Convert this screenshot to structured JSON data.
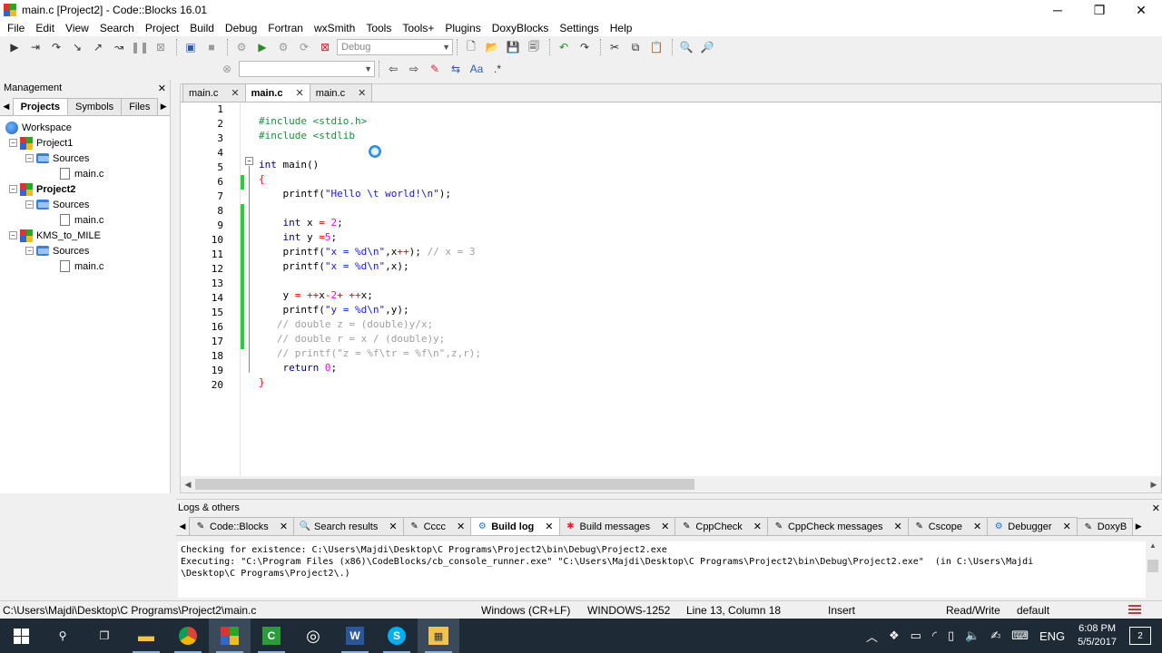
{
  "window": {
    "title": "main.c [Project2] - Code::Blocks 16.01",
    "minimize": "─",
    "maximize": "❐",
    "close": "✕"
  },
  "menu": [
    "File",
    "Edit",
    "View",
    "Search",
    "Project",
    "Build",
    "Debug",
    "Fortran",
    "wxSmith",
    "Tools",
    "Tools+",
    "Plugins",
    "DoxyBlocks",
    "Settings",
    "Help"
  ],
  "toolbar": {
    "build_target": "Debug",
    "search_combo": ""
  },
  "management": {
    "title": "Management",
    "tabs": [
      "Projects",
      "Symbols",
      "Files"
    ],
    "workspace": "Workspace",
    "projects": [
      {
        "name": "Project1",
        "folder": "Sources",
        "file": "main.c"
      },
      {
        "name": "Project2",
        "folder": "Sources",
        "file": "main.c"
      },
      {
        "name": "KMS_to_MILE",
        "folder": "Sources",
        "file": "main.c"
      }
    ]
  },
  "editor_tabs": [
    {
      "label": "main.c",
      "active": false
    },
    {
      "label": "main.c",
      "active": true
    },
    {
      "label": "main.c",
      "active": false
    }
  ],
  "line_numbers": [
    "1",
    "2",
    "3",
    "4",
    "5",
    "6",
    "7",
    "8",
    "9",
    "10",
    "11",
    "12",
    "13",
    "14",
    "15",
    "16",
    "17",
    "18",
    "19",
    "20"
  ],
  "logs": {
    "title": "Logs & others",
    "tabs": [
      "Code::Blocks",
      "Search results",
      "Cccc",
      "Build log",
      "Build messages",
      "CppCheck",
      "CppCheck messages",
      "Cscope",
      "Debugger",
      "DoxyB"
    ],
    "lines": [
      "Checking for existence: C:\\Users\\Majdi\\Desktop\\C Programs\\Project2\\bin\\Debug\\Project2.exe",
      "Executing: \"C:\\Program Files (x86)\\CodeBlocks/cb_console_runner.exe\" \"C:\\Users\\Majdi\\Desktop\\C Programs\\Project2\\bin\\Debug\\Project2.exe\"  (in C:\\Users\\Majdi",
      "\\Desktop\\C Programs\\Project2\\.)"
    ]
  },
  "status": {
    "path": "C:\\Users\\Majdi\\Desktop\\C Programs\\Project2\\main.c",
    "eol": "Windows (CR+LF)",
    "encoding": "WINDOWS-1252",
    "position": "Line 13, Column 18",
    "mode": "Insert",
    "access": "Read/Write",
    "lang": "default"
  },
  "taskbar": {
    "time": "6:08 PM",
    "date": "5/5/2017",
    "lang": "ENG",
    "notifications": "2"
  }
}
